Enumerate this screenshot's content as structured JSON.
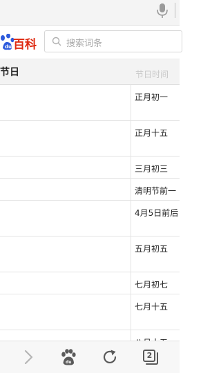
{
  "browser": {
    "mic_icon": "microphone-icon",
    "tab_count": "2"
  },
  "header": {
    "logo_text": "百科",
    "search_placeholder": "搜索词条"
  },
  "table": {
    "col1_header": "节日",
    "col2_header": "节日时间",
    "rows": [
      {
        "time": "正月初一"
      },
      {
        "time": "正月十五"
      },
      {
        "time": "三月初三"
      },
      {
        "time": "清明节前一"
      },
      {
        "time": "4月5日前后"
      },
      {
        "time": "五月初五"
      },
      {
        "time": "七月初七"
      },
      {
        "time": "七月十五"
      },
      {
        "time": "八月十五"
      }
    ]
  },
  "toolbar": {
    "icons": [
      "forward-icon",
      "paw-home-icon",
      "refresh-icon",
      "tabs-icon"
    ]
  }
}
